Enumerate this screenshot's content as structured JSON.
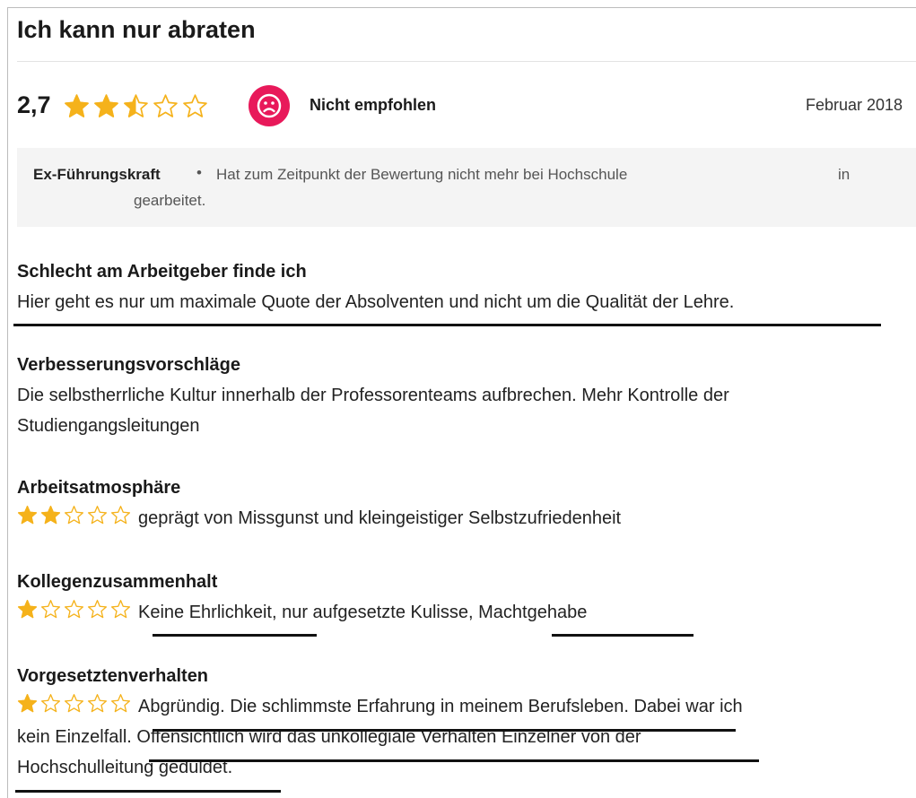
{
  "review": {
    "title": "Ich kann nur abraten",
    "score": "2,7",
    "score_stars": 2.5,
    "recommendation": "Nicht empfohlen",
    "recommendation_icon": "sad-face-icon",
    "date": "Februar 2018",
    "accent_color": "#e8195a",
    "star_color": "#f5b21b"
  },
  "info": {
    "role": "Ex-Führungskraft",
    "separator": "•",
    "text_line1": "Hat zum Zeitpunkt der Bewertung nicht mehr bei Hochschule",
    "text_in": "in",
    "text_line2": "gearbeitet."
  },
  "sections": {
    "schlecht": {
      "heading": "Schlecht am Arbeitgeber finde ich",
      "text": "Hier geht es nur um maximale Quote der Absolventen und nicht um die Qualität der Lehre."
    },
    "verbesserung": {
      "heading": "Verbesserungsvorschläge",
      "line1": "Die selbstherrliche Kultur innerhalb der Professorenteams aufbrechen. Mehr Kontrolle der",
      "line2": "Studiengangsleitungen"
    },
    "atmosphaere": {
      "heading": "Arbeitsatmosphäre",
      "stars": 2,
      "text": "geprägt von Missgunst und kleingeistiger Selbstzufriedenheit"
    },
    "kollegen": {
      "heading": "Kollegenzusammenhalt",
      "stars": 1,
      "part1": "Keine Ehrlichkeit",
      "part2": ", nur aufgesetzte Kulisse, ",
      "part3": "Machtgehabe"
    },
    "vorgesetzte": {
      "heading": "Vorgesetztenverhalten",
      "stars": 1,
      "line1_a": "Abgründig. Die schlimmste Erfahrung in meinem Berufsleben.",
      "line1_b": " Dabei war ich",
      "line2_a": "kein Einzelfall. ",
      "line2_b": "Offensichtlich wird das unkollegiale Verhalten Einzelner von der",
      "line3": "Hochschulleitung geduldet."
    }
  }
}
